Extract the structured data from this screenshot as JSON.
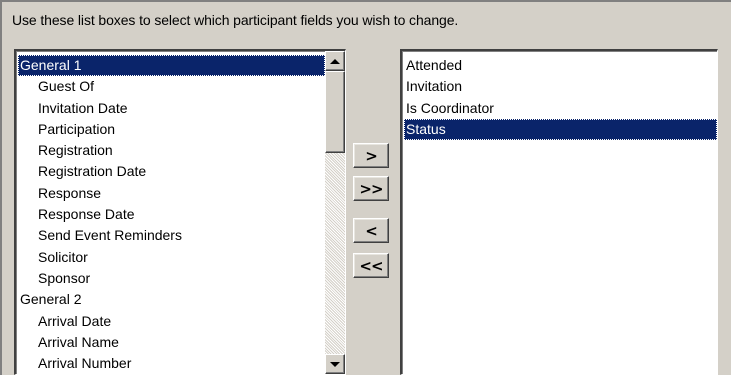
{
  "instruction": "Use these list boxes to select which participant fields you wish to change.",
  "available_fields": {
    "items": [
      {
        "label": "General 1",
        "indent": false,
        "selected": true
      },
      {
        "label": "Guest Of",
        "indent": true,
        "selected": false
      },
      {
        "label": "Invitation Date",
        "indent": true,
        "selected": false
      },
      {
        "label": "Participation",
        "indent": true,
        "selected": false
      },
      {
        "label": "Registration",
        "indent": true,
        "selected": false
      },
      {
        "label": "Registration Date",
        "indent": true,
        "selected": false
      },
      {
        "label": "Response",
        "indent": true,
        "selected": false
      },
      {
        "label": "Response Date",
        "indent": true,
        "selected": false
      },
      {
        "label": "Send Event Reminders",
        "indent": true,
        "selected": false
      },
      {
        "label": "Solicitor",
        "indent": true,
        "selected": false
      },
      {
        "label": "Sponsor",
        "indent": true,
        "selected": false
      },
      {
        "label": "General 2",
        "indent": false,
        "selected": false
      },
      {
        "label": "Arrival Date",
        "indent": true,
        "selected": false
      },
      {
        "label": "Arrival Name",
        "indent": true,
        "selected": false
      },
      {
        "label": "Arrival Number",
        "indent": true,
        "selected": false
      }
    ]
  },
  "selected_fields": {
    "items": [
      {
        "label": "Attended",
        "selected": false
      },
      {
        "label": "Invitation",
        "selected": false
      },
      {
        "label": "Is Coordinator",
        "selected": false
      },
      {
        "label": "Status",
        "selected": true
      }
    ]
  },
  "buttons": {
    "add": ">",
    "add_all": ">>",
    "remove": "<",
    "remove_all": "<<"
  },
  "colors": {
    "selection_bg": "#0a246a",
    "face": "#d4d0c8"
  }
}
